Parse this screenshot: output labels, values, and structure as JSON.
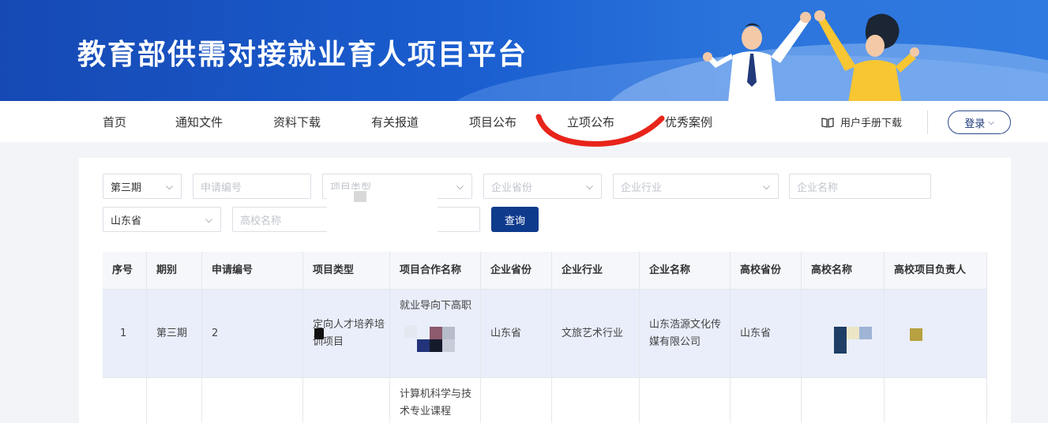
{
  "banner": {
    "title": "教育部供需对接就业育人项目平台"
  },
  "nav": {
    "items": [
      "首页",
      "通知文件",
      "资料下载",
      "有关报道",
      "项目公布",
      "立项公布",
      "优秀案例"
    ],
    "manual_label": "用户手册下载",
    "login_label": "登录"
  },
  "filters": {
    "period_value": "第三期",
    "application_no_placeholder": "申请编号",
    "project_type_placeholder": "项目类型",
    "company_province_placeholder": "企业省份",
    "company_industry_placeholder": "企业行业",
    "company_name_placeholder": "企业名称",
    "school_province_value": "山东省",
    "school_name_placeholder": "高校名称",
    "query_label": "查询"
  },
  "table": {
    "columns": [
      "序号",
      "期别",
      "申请编号",
      "项目类型",
      "项目合作名称",
      "企业省份",
      "企业行业",
      "企业名称",
      "高校省份",
      "高校名称",
      "高校项目负责人"
    ],
    "rows": [
      {
        "index": "1",
        "period": "第三期",
        "application_no": "2",
        "project_type": "定向人才培养培训项目",
        "project_name": "就业导向下高职",
        "company_province": "山东省",
        "company_industry": "文旅艺术行业",
        "company_name": "山东浩源文化传媒有限公司",
        "school_province": "山东省"
      },
      {
        "project_name": "计算机科学与技术专业课程"
      }
    ]
  }
}
